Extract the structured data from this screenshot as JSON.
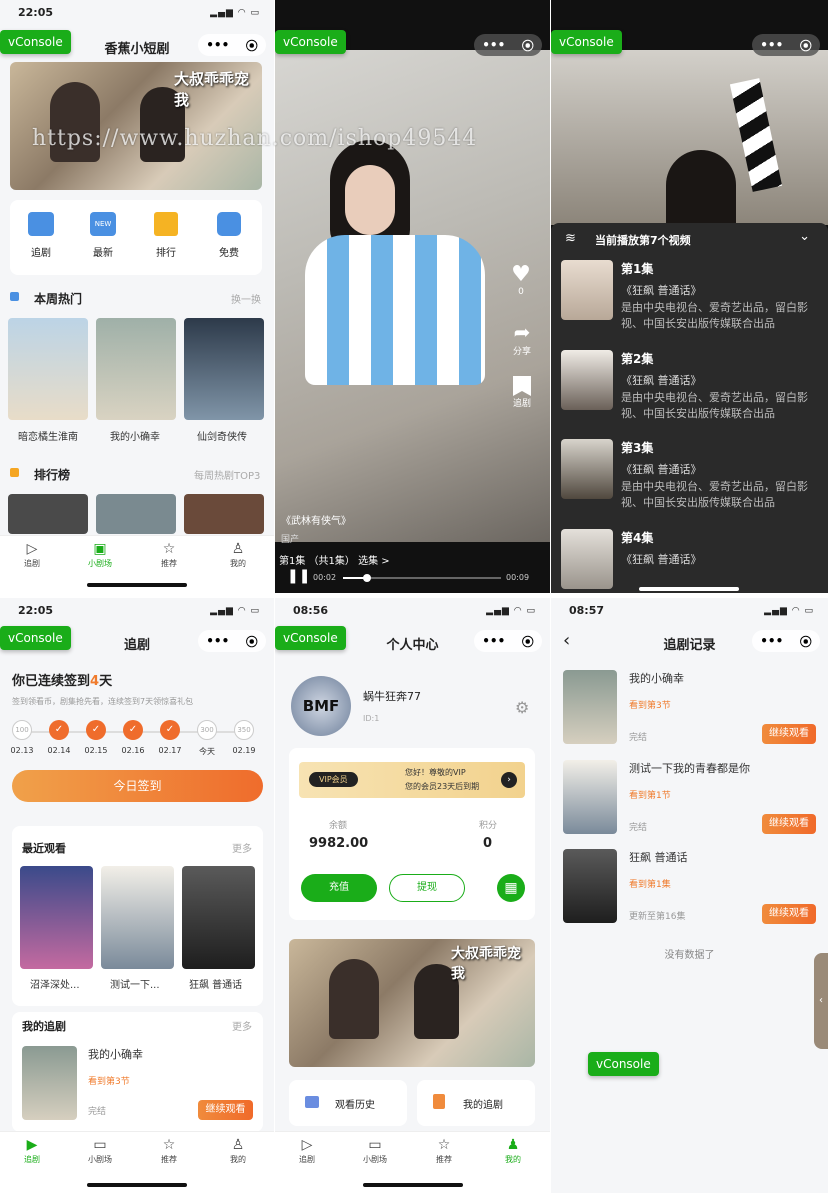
{
  "watermark": "https://www.huzhan.com/ishop49544",
  "vconsole_label": "vConsole",
  "capsule": {
    "more": "•••",
    "close": "⦿"
  },
  "p1": {
    "time": "22:05",
    "status": "▂▄▆ ◠ ▭",
    "title": "香蕉小短剧",
    "banner_text": "大叔乖乖宠我",
    "menu": [
      {
        "label": "追剧",
        "icon": "tv-icon",
        "color": "#3b8bea"
      },
      {
        "label": "最新",
        "icon": "new-icon",
        "color": "#3b8bea"
      },
      {
        "label": "排行",
        "icon": "rank-icon",
        "color": "#f5a623"
      },
      {
        "label": "免费",
        "icon": "free-icon",
        "color": "#3b8bea"
      }
    ],
    "hot": {
      "title": "本周热门",
      "more": "换一换",
      "items": [
        "暗恋橘生淮南",
        "我的小确幸",
        "仙剑奇侠传"
      ]
    },
    "rank": {
      "title": "排行榜",
      "more": "每周热剧TOP3"
    },
    "tabs": [
      "追剧",
      "小剧场",
      "推荐",
      "我的"
    ]
  },
  "p2": {
    "likes": "0",
    "share": "分享",
    "follow": "追剧",
    "caption": "《武林有侠气》",
    "caption2": "国产",
    "ep_line": "第1集 （共1集） 选集 >",
    "t_start": "00:02",
    "t_end": "00:09",
    "progress": 0.15
  },
  "p3": {
    "header": "当前播放第7个视频",
    "episodes": [
      {
        "t": "第1集",
        "s": "《狂飙 普通话》",
        "d": "是由中央电视台、爱奇艺出品，留白影视、中国长安出版传媒联合出品"
      },
      {
        "t": "第2集",
        "s": "《狂飙 普通话》",
        "d": "是由中央电视台、爱奇艺出品，留白影视、中国长安出版传媒联合出品"
      },
      {
        "t": "第3集",
        "s": "《狂飙 普通话》",
        "d": "是由中央电视台、爱奇艺出品，留白影视、中国长安出版传媒联合出品"
      },
      {
        "t": "第4集",
        "s": "《狂飙 普通话》",
        "d": ""
      }
    ]
  },
  "p4": {
    "time": "22:05",
    "title": "追剧",
    "sign_prefix": "你已连续签到",
    "sign_days": "4",
    "sign_suffix": "天",
    "sign_desc": "签到领看币，剧集抢先看，连续签到7天领惊喜礼包",
    "days": [
      {
        "v": "100",
        "d": "02.13",
        "done": false
      },
      {
        "v": "✓",
        "d": "02.14",
        "done": true
      },
      {
        "v": "✓",
        "d": "02.15",
        "done": true
      },
      {
        "v": "✓",
        "d": "02.16",
        "done": true
      },
      {
        "v": "✓",
        "d": "02.17",
        "done": true
      },
      {
        "v": "300",
        "d": "今天",
        "done": false
      },
      {
        "v": "350",
        "d": "02.19",
        "done": false
      }
    ],
    "sign_btn": "今日签到",
    "recent": {
      "title": "最近观看",
      "more": "更多",
      "items": [
        "沼泽深处...",
        "测试一下...",
        "狂飙 普通话"
      ]
    },
    "mine": {
      "title": "我的追剧",
      "more": "更多",
      "name": "我的小确幸",
      "ep": "看到第3节",
      "status": "完结",
      "btn": "继续观看"
    },
    "tabs": [
      "追剧",
      "小剧场",
      "推荐",
      "我的"
    ]
  },
  "p5": {
    "time": "08:56",
    "title": "个人中心",
    "user": "蜗牛狂奔77",
    "uid": "ID:1",
    "avatar_text": "BMF",
    "vip_badge": "VIP会员",
    "vip_text1": "您好！尊敬的VIP",
    "vip_text2": "您的会员23天后到期",
    "balance_label": "余额",
    "balance": "9982.00",
    "points_label": "积分",
    "points": "0",
    "recharge": "充值",
    "withdraw": "提现",
    "banner_text": "大叔乖乖宠我",
    "history": "观看历史",
    "mychase": "我的追剧",
    "tabs": [
      "追剧",
      "小剧场",
      "推荐",
      "我的"
    ]
  },
  "p6": {
    "time": "08:57",
    "title": "追剧记录",
    "items": [
      {
        "name": "我的小确幸",
        "ep": "看到第3节",
        "status": "完结",
        "btn": "继续观看"
      },
      {
        "name": "测试一下我的青春都是你",
        "ep": "看到第1节",
        "status": "完结",
        "btn": "继续观看"
      },
      {
        "name": "狂飙 普通话",
        "ep": "看到第1集",
        "status": "更新至第16集",
        "btn": "继续观看"
      }
    ],
    "empty": "没有数据了"
  }
}
